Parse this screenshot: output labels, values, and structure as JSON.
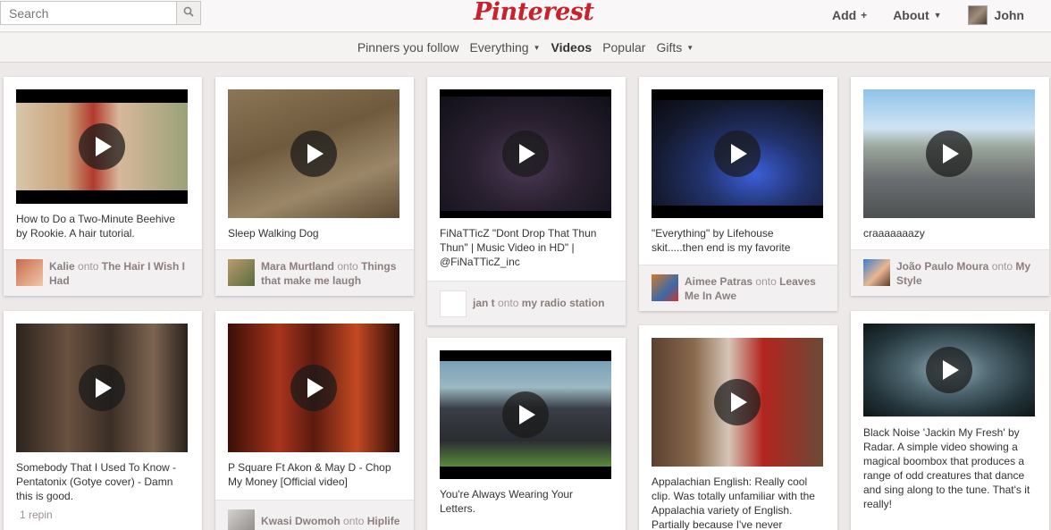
{
  "header": {
    "search_placeholder": "Search",
    "logo": "Pinterest",
    "add_label": "Add",
    "add_icon": "+",
    "about_label": "About",
    "user_label": "John"
  },
  "subnav": {
    "items": [
      "Pinners you follow",
      "Everything",
      "Videos",
      "Popular",
      "Gifts"
    ]
  },
  "pins": [
    {
      "desc": "How to Do a Two-Minute Beehive by Rookie. A hair tutorial.",
      "user": "Kalie",
      "onto": "onto",
      "board": "The Hair I Wish I Had"
    },
    {
      "desc": "Sleep Walking Dog",
      "user": "Mara Murtland",
      "onto": "onto",
      "board": "Things that make me laugh"
    },
    {
      "desc": "FiNaTTicZ \"Dont Drop That Thun Thun\" | Music Video in HD\" | @FiNaTTicZ_inc",
      "user": "jan t",
      "onto": "onto",
      "board": "my radio station"
    },
    {
      "desc": "\"Everything\" by Lifehouse skit.....then end is my favorite",
      "user": "Aimee Patras",
      "onto": "onto",
      "board": "Leaves Me In Awe"
    },
    {
      "desc": "craaaaaaazy",
      "user": "João Paulo Moura",
      "onto": "onto",
      "board": "My Style"
    },
    {
      "desc": "Somebody That I Used To Know - Pentatonix (Gotye cover) - Damn this is good.",
      "repins": "1 repin"
    },
    {
      "desc": "P Square Ft Akon & May D - Chop My Money [Official video]",
      "user": "Kwasi Dwomoh",
      "onto": "onto",
      "board": "Hiplife"
    },
    {
      "desc": "You're Always Wearing Your Letters."
    },
    {
      "desc": "Appalachian English: Really cool clip. Was totally unfamiliar with the Appalachia variety of English. Partially because I've never"
    },
    {
      "desc": "Black Noise 'Jackin My Fresh' by Radar. A simple video showing a magical boombox that produces a range of odd creatures that dance and sing along to the tune. That's it really!"
    }
  ],
  "icons": {
    "search": "search-icon",
    "play": "play-icon"
  }
}
